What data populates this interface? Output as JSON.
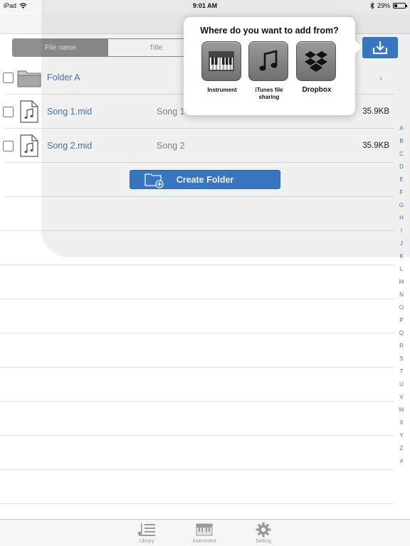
{
  "status": {
    "device": "iPad",
    "time": "9:01 AM",
    "battery": "29%",
    "battery_level": 0.29
  },
  "segments": [
    {
      "label": "File name",
      "active": true
    },
    {
      "label": "Title",
      "active": false
    }
  ],
  "files": [
    {
      "name": "Folder A",
      "type": "folder",
      "title": "",
      "size": ""
    },
    {
      "name": "Song 1.mid",
      "type": "file",
      "title": "Song 1",
      "size": "35.9KB"
    },
    {
      "name": "Song 2.mid",
      "type": "file",
      "title": "Song 2",
      "size": "35.9KB"
    }
  ],
  "create_folder_label": "Create Folder",
  "popover": {
    "title": "Where do you want to add from?",
    "options": [
      {
        "label": "Instrument",
        "icon": "piano-icon"
      },
      {
        "label": "iTunes file sharing",
        "icon": "music-note-icon"
      },
      {
        "label": "Dropbox",
        "icon": "dropbox-icon"
      }
    ]
  },
  "index_letters": [
    "A",
    "B",
    "C",
    "D",
    "E",
    "F",
    "G",
    "H",
    "I",
    "J",
    "K",
    "L",
    "M",
    "N",
    "O",
    "P",
    "Q",
    "R",
    "S",
    "T",
    "U",
    "V",
    "W",
    "X",
    "Y",
    "Z",
    "#"
  ],
  "tabs": [
    {
      "label": "Library",
      "icon": "library-icon"
    },
    {
      "label": "Instrument",
      "icon": "piano-icon"
    },
    {
      "label": "Setting",
      "icon": "gear-icon"
    }
  ],
  "colors": {
    "accent": "#3c7fcd",
    "link": "#4a7ab8",
    "segment_active": "#8f8f8f"
  }
}
